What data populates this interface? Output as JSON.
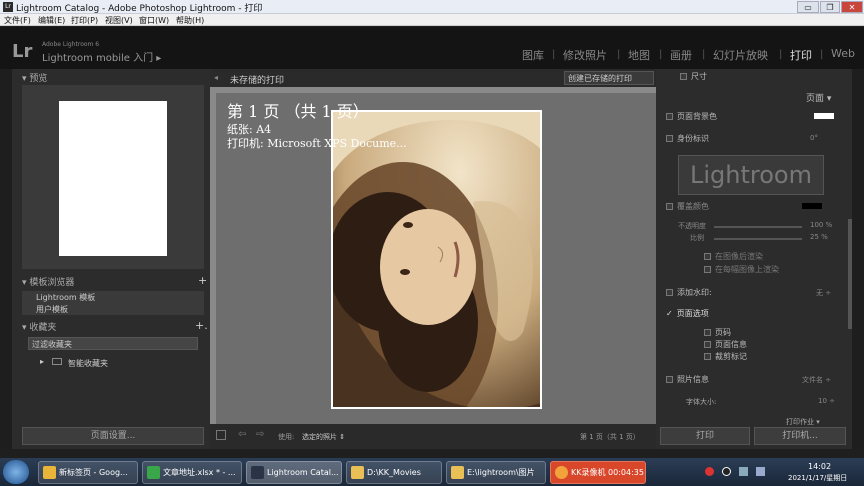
{
  "window": {
    "title": "Lightroom Catalog - Adobe Photoshop Lightroom - 打印",
    "app_icon": "Lr",
    "min": "▭",
    "max": "❐",
    "close": "✕"
  },
  "menu": [
    "文件(F)",
    "编辑(E)",
    "打印(P)",
    "视图(V)",
    "窗口(W)",
    "帮助(H)"
  ],
  "header": {
    "logo": "Lr",
    "version": "Adobe Lightroom 6",
    "mobile": "Lightroom mobile 入门 ▸",
    "modules": [
      "图库",
      "修改照片",
      "地图",
      "画册",
      "幻灯片放映",
      "打印",
      "Web"
    ],
    "active_module": "打印"
  },
  "left": {
    "preview_title": "▾ 预览",
    "template_title": "▾ 模板浏览器",
    "template_items": [
      "Lightroom 模板",
      "用户模板"
    ],
    "collection_title": "▾ 收藏夹",
    "collection_filter": "过滤收藏夹",
    "collection_items": [
      "智能收藏夹"
    ],
    "page_setup": "页面设置..."
  },
  "center": {
    "doc_title": "未存储的打印",
    "save_button": "创建已存储的打印",
    "overlay_line1": "第 1 页 （共 1 页）",
    "overlay_line2": "纸张: A4",
    "overlay_line3": "打印机: Microsoft XPS Docume...",
    "use_label": "使用:",
    "use_value": "选定的照片 ⇕",
    "page_status": "第 1 页（共 1 页）"
  },
  "right": {
    "size_label": "尺寸",
    "page_section": "页面 ▾",
    "page_bg": "页面背景色",
    "identity": "身份标识",
    "identity_angle": "0°",
    "identity_plate": "Lightroom",
    "override_color": "覆盖颜色",
    "opacity_label": "不透明度",
    "opacity_value": "100 %",
    "scale_label": "比例",
    "scale_value": "25 %",
    "behind_image": "在图像后渲染",
    "each_image": "在每幅图像上渲染",
    "watermark": "添加水印:",
    "watermark_value": "无 ÷",
    "page_options": "页面选项",
    "page_numbers": "页码",
    "page_info": "页面信息",
    "crop_marks": "裁剪标记",
    "photo_info": "照片信息",
    "photo_info_value": "文件名 ÷",
    "font_size": "字体大小:",
    "font_size_value": "10 ÷",
    "print_job": "打印作业 ▾",
    "print_btn": "打印",
    "printer_btn": "打印机..."
  },
  "taskbar": {
    "items": [
      "新标签页 - Goog...",
      "文章地址.xlsx * - ...",
      "Lightroom Catal...",
      "D:\\KK_Movies",
      "E:\\lightroom\\图片",
      "KK录像机 00:04:35"
    ],
    "time": "14:02",
    "date": "2021/1/17/星期日"
  },
  "colors": {
    "accent": "#e0e0e0",
    "taskbar": "#1a2739",
    "record": "#d9472b"
  }
}
